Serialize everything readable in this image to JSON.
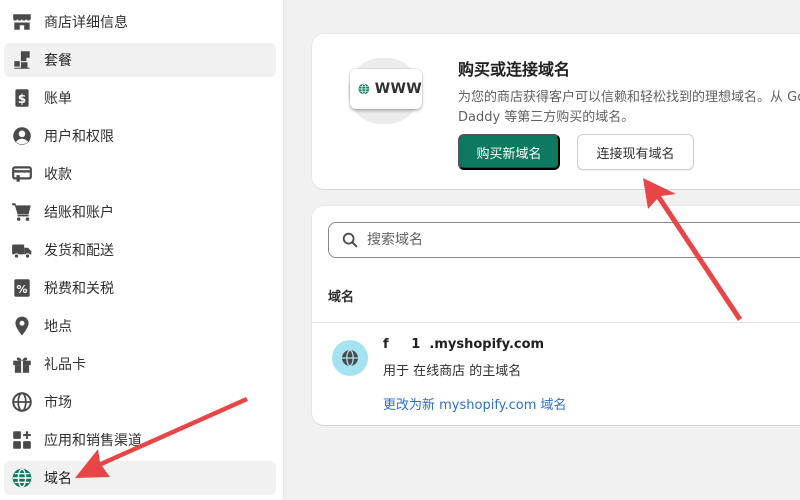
{
  "sidebar": {
    "items": [
      {
        "label": "商店详细信息",
        "icon": "store-icon"
      },
      {
        "label": "套餐",
        "icon": "plan-icon"
      },
      {
        "label": "账单",
        "icon": "billing-icon"
      },
      {
        "label": "用户和权限",
        "icon": "user-icon"
      },
      {
        "label": "收款",
        "icon": "payments-icon"
      },
      {
        "label": "结账和账户",
        "icon": "cart-icon"
      },
      {
        "label": "发货和配送",
        "icon": "truck-icon"
      },
      {
        "label": "税费和关税",
        "icon": "tax-icon"
      },
      {
        "label": "地点",
        "icon": "location-icon"
      },
      {
        "label": "礼品卡",
        "icon": "gift-icon"
      },
      {
        "label": "市场",
        "icon": "globe-icon"
      },
      {
        "label": "应用和销售渠道",
        "icon": "apps-icon"
      },
      {
        "label": "域名",
        "icon": "domain-globe-icon",
        "active": true
      }
    ]
  },
  "promo": {
    "badge_text": "WWW",
    "title": "购买或连接域名",
    "description": "为您的商店获得客户可以信赖和轻松找到的理想域名。从 GoDaddy 等第三方购买的域名。",
    "buy_label": "购买新域名",
    "connect_label": "连接现有域名"
  },
  "domains": {
    "search_placeholder": "搜索域名",
    "column_header": "域名",
    "rows": [
      {
        "name": "f     1  .myshopify.com",
        "role": "用于 在线商店 的主域名",
        "change_link": "更改为新 myshopify.com 域名"
      }
    ]
  },
  "colors": {
    "primary": "#0d7a5f",
    "link": "#2c6ecb",
    "active_icon": "#0d7a5f",
    "globe_bg": "#a6e3f0",
    "arrow": "#e84646"
  }
}
